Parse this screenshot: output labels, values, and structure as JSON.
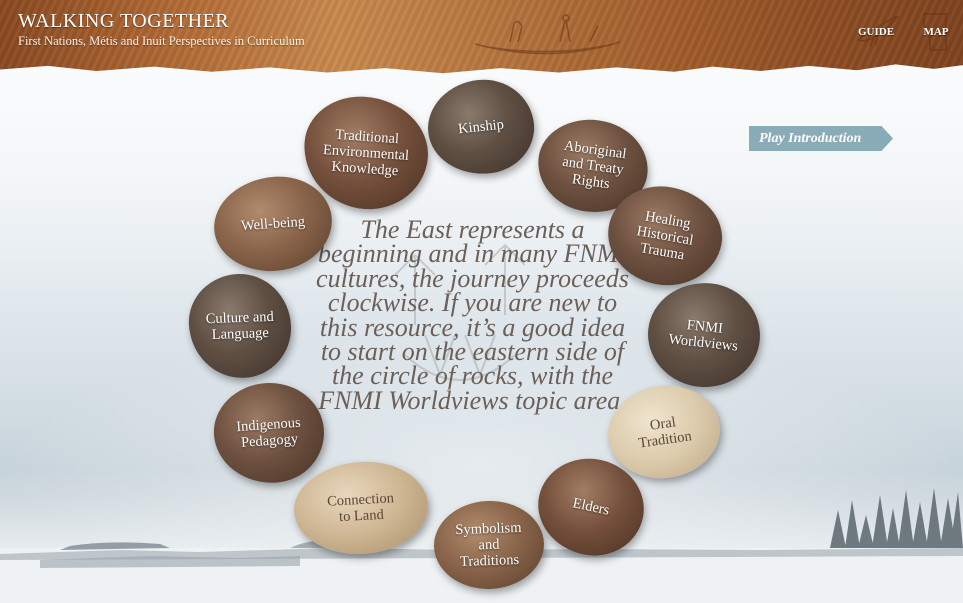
{
  "header": {
    "title": "WALKING TOGETHER",
    "subtitle": "First Nations, Métis and Inuit Perspectives in Curriculum",
    "nav": {
      "guide_label": "GUIDE",
      "map_label": "MAP"
    }
  },
  "intro_button": {
    "label": "Play Introduction"
  },
  "center_message": "The East represents a beginning and in many FNMI cultures, the journey proceeds clockwise. If you are new to this resource, it’s a good idea to start on the eastern side of the circle of rocks, with the FNMI Worldviews topic area.",
  "rocks": {
    "kinship": "Kinship",
    "traditional_environmental_knowledge": "Traditional\nEnvironmental\nKnowledge",
    "aboriginal_treaty_rights": "Aboriginal\nand Treaty\nRights",
    "well_being": "Well-being",
    "healing_historical_trauma": "Healing\nHistorical\nTrauma",
    "culture_language": "Culture and\nLanguage",
    "fnmi_worldviews": "FNMI\nWorldviews",
    "indigenous_pedagogy": "Indigenous\nPedagogy",
    "oral_tradition": "Oral\nTradition",
    "connection_to_land": "Connection\nto Land",
    "elders": "Elders",
    "symbolism_traditions": "Symbolism\nand\nTraditions"
  },
  "colors": {
    "header_leather": "#b26a35",
    "play_button": "#8aabb8",
    "center_text": "#6b5f57"
  },
  "icons": {
    "guide": "raven-icon",
    "map": "alberta-map-icon",
    "header_art": "canoe-petroglyph-icon"
  }
}
